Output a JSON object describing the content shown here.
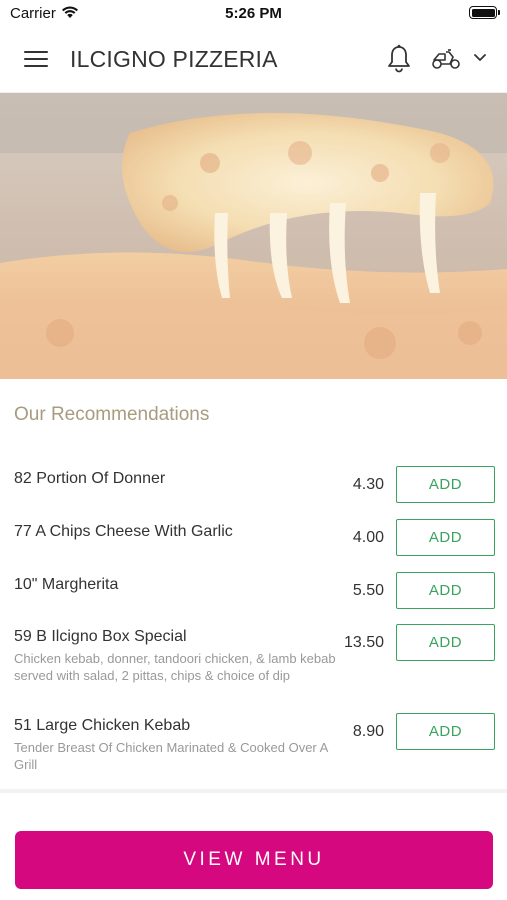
{
  "status_bar": {
    "carrier": "Carrier",
    "time": "5:26 PM"
  },
  "header": {
    "title": "ILCIGNO PIZZERIA"
  },
  "section": {
    "title": "Our Recommendations"
  },
  "recommendations": [
    {
      "name": "82 Portion Of Donner",
      "description": "",
      "price": "4.30",
      "button": "ADD"
    },
    {
      "name": "77 A Chips Cheese With Garlic",
      "description": "",
      "price": "4.00",
      "button": "ADD"
    },
    {
      "name": "10\" Margherita",
      "description": "",
      "price": "5.50",
      "button": "ADD"
    },
    {
      "name": "59 B Ilcigno Box Special",
      "description": "Chicken kebab, donner, tandoori chicken, & lamb kebab served with salad, 2 pittas, chips & choice of dip",
      "price": "13.50",
      "button": "ADD"
    },
    {
      "name": "51 Large Chicken Kebab",
      "description": "Tender Breast Of Chicken Marinated & Cooked Over A Grill",
      "price": "8.90",
      "button": "ADD"
    }
  ],
  "footer": {
    "view_menu": "VIEW MENU"
  },
  "colors": {
    "accent": "#d6087f",
    "add_green": "#3aa35f",
    "section_title": "#a99b7f"
  },
  "icons": [
    "hamburger-menu-icon",
    "bell-icon",
    "scooter-icon",
    "chevron-down-icon",
    "wifi-icon",
    "battery-icon"
  ]
}
